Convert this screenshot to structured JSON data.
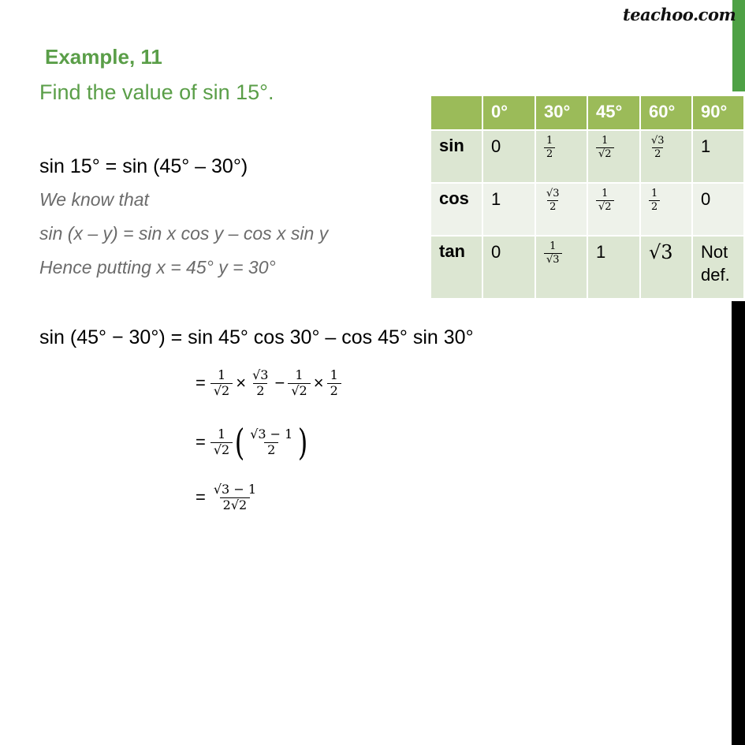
{
  "brand": {
    "logo_text": "teachoo.com"
  },
  "colors": {
    "accent_green": "#5a9e48",
    "table_header": "#9bbb59",
    "row_dark": "#dce6d2",
    "row_light": "#eef2ea",
    "side_green": "#4ea145",
    "side_black": "#000000"
  },
  "heading": {
    "example": "Example,  11",
    "question": "Find the value of sin 15°."
  },
  "solution": {
    "line1": "sin 15° = sin (45° – 30°)",
    "know": "We know that",
    "identity": "sin (x – y) = sin x cos y – cos x sin y",
    "putting": "Hence putting x = 45°  y = 30°",
    "expansion": "sin (45° − 30°) = sin 45°  cos 30° – cos 45° sin 30°",
    "step1": {
      "eq": "=",
      "t1": {
        "num": "1",
        "den": "√2"
      },
      "times1": "×",
      "t2": {
        "num": "√3",
        "den": "2"
      },
      "minus": "−",
      "t3": {
        "num": "1",
        "den": "√2"
      },
      "times2": "×",
      "t4": {
        "num": "1",
        "den": "2"
      }
    },
    "step2": {
      "eq": "=",
      "t1": {
        "num": "1",
        "den": "√2"
      },
      "lparen": "(",
      "t2": {
        "num": "√3 − 1",
        "den": "2"
      },
      "rparen": ")"
    },
    "step3": {
      "eq": "=",
      "t1": {
        "num": "√3 − 1",
        "den": "2√2"
      }
    }
  },
  "trig_table": {
    "headers": [
      "",
      "0°",
      "30°",
      "45°",
      "60°",
      "90°"
    ],
    "rows": [
      {
        "func": "sin",
        "cells": [
          {
            "text": "0"
          },
          {
            "num": "1",
            "den": "2"
          },
          {
            "num": "1",
            "den": "√2"
          },
          {
            "num": "√3",
            "den": "2"
          },
          {
            "text": "1"
          }
        ]
      },
      {
        "func": "cos",
        "cells": [
          {
            "text": "1"
          },
          {
            "num": "√3",
            "den": "2"
          },
          {
            "num": "1",
            "den": "√2"
          },
          {
            "num": "1",
            "den": "2"
          },
          {
            "text": "0"
          }
        ]
      },
      {
        "func": "tan",
        "cells": [
          {
            "text": "0"
          },
          {
            "num": "1",
            "den": "√3"
          },
          {
            "text": "1"
          },
          {
            "root": "√3"
          },
          {
            "text": "Not def."
          }
        ]
      }
    ]
  }
}
